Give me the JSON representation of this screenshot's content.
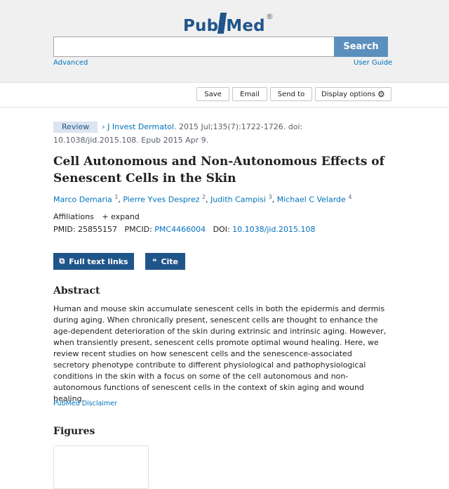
{
  "logo": {
    "part1": "Pub",
    "part2": "Med",
    "reg": "®"
  },
  "search": {
    "button": "Search",
    "placeholder": "",
    "advanced": "Advanced",
    "user_guide": "User Guide"
  },
  "actions": {
    "save": "Save",
    "email": "Email",
    "send_to": "Send to",
    "display_options": "Display options"
  },
  "citation": {
    "badge": "Review",
    "journal": "J Invest Dermatol",
    "details": ". 2015 Jul;135(7):1722-1726. doi: 10.1038/jid.2015.108.",
    "epub": "Epub 2015 Apr 9."
  },
  "title": "Cell Autonomous and Non-Autonomous Effects of Senescent Cells in the Skin",
  "authors": [
    {
      "name": "Marco Demaria",
      "sup": "1"
    },
    {
      "name": "Pierre Yves Desprez",
      "sup": "2"
    },
    {
      "name": "Judith Campisi",
      "sup": "3"
    },
    {
      "name": "Michael C Velarde",
      "sup": "4"
    }
  ],
  "affiliations": {
    "label": "Affiliations",
    "expand": "expand"
  },
  "ids": {
    "pmid_label": "PMID:",
    "pmid": "25855157",
    "pmcid_label": "PMCID:",
    "pmcid": "PMC4466004",
    "doi_label": "DOI:",
    "doi": "10.1038/jid.2015.108"
  },
  "buttons": {
    "full_text": "Full text links",
    "cite": "Cite"
  },
  "abstract": {
    "heading": "Abstract",
    "text": "Human and mouse skin accumulate senescent cells in both the epidermis and dermis during aging. When chronically present, senescent cells are thought to enhance the age-dependent deterioration of the skin during extrinsic and intrinsic aging. However, when transiently present, senescent cells promote optimal wound healing. Here, we review recent studies on how senescent cells and the senescence-associated secretory phenotype contribute to different physiological and pathophysiological conditions in the skin with a focus on some of the cell autonomous and non-autonomous functions of senescent cells in the context of skin aging and wound healing.",
    "disclaimer": "PubMed Disclaimer"
  },
  "figures": {
    "heading": "Figures"
  },
  "colors": {
    "brand": "#20558a",
    "link": "#0071bc",
    "search_button": "#5b8fbd"
  },
  "icons": {
    "gear": "gear-icon",
    "external": "external-link-icon",
    "quote": "quote-icon",
    "chevron": "chevron-right-icon",
    "plus": "plus-icon"
  }
}
